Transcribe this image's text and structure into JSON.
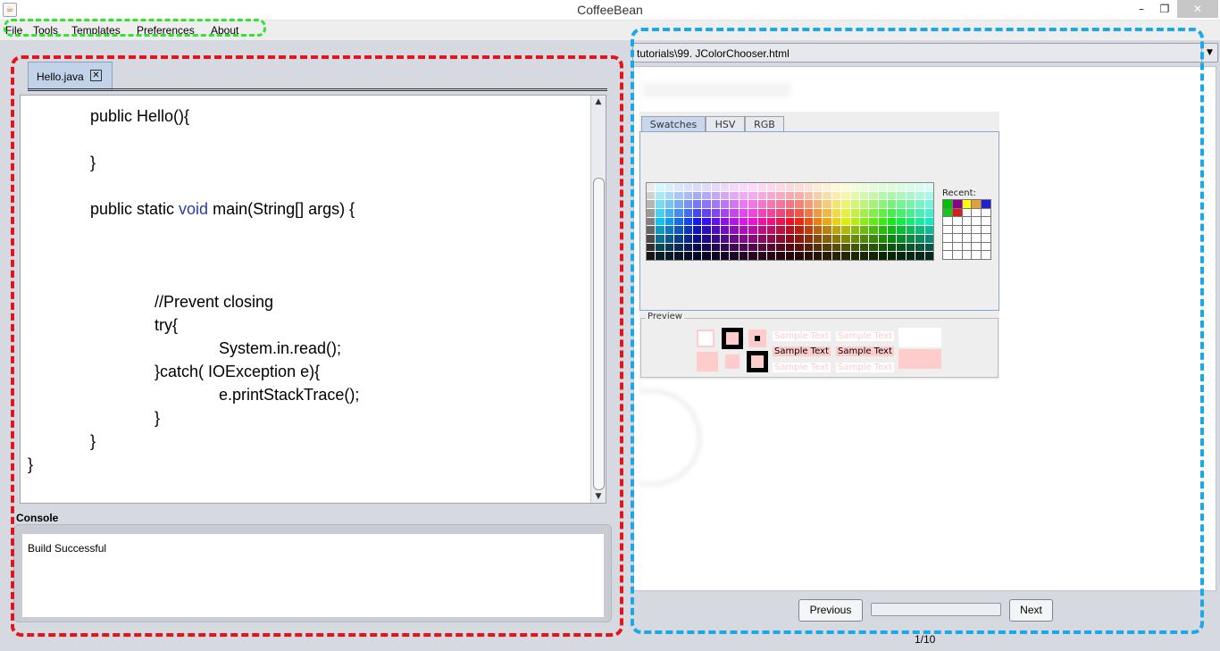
{
  "window": {
    "title": "CoffeeBean",
    "minimize": "–",
    "maximize": "❐",
    "close": "✕"
  },
  "menu": [
    "File",
    "Tools",
    "Templates",
    "Preferences",
    "About"
  ],
  "editor": {
    "tab_label": "Hello.java",
    "tab_close": "✕",
    "lines": [
      {
        "indent": 1,
        "segments": [
          {
            "text": "public Hello(){",
            "kind": "plain"
          }
        ]
      },
      {
        "indent": 1,
        "segments": [
          {
            "text": "}",
            "kind": "plain"
          }
        ]
      },
      {
        "indent": 1,
        "segments": [
          {
            "text": "public static ",
            "kind": "plain"
          },
          {
            "text": "void",
            "kind": "keyword"
          },
          {
            "text": " main(String[] args) {",
            "kind": "plain"
          }
        ]
      },
      {
        "indent": 2,
        "segments": [
          {
            "text": "//Prevent closing",
            "kind": "plain"
          }
        ]
      },
      {
        "indent": 2,
        "segments": [
          {
            "text": "try{",
            "kind": "plain"
          }
        ]
      },
      {
        "indent": 3,
        "segments": [
          {
            "text": "System.in.read();",
            "kind": "plain"
          }
        ]
      },
      {
        "indent": 2,
        "segments": [
          {
            "text": "}catch( IOException e){",
            "kind": "plain"
          }
        ]
      },
      {
        "indent": 3,
        "segments": [
          {
            "text": "e.printStackTrace();",
            "kind": "plain"
          }
        ]
      },
      {
        "indent": 2,
        "segments": [
          {
            "text": "}",
            "kind": "plain"
          }
        ]
      },
      {
        "indent": 1,
        "segments": [
          {
            "text": "}",
            "kind": "plain"
          }
        ]
      },
      {
        "indent": 0,
        "segments": [
          {
            "text": "}",
            "kind": "plain"
          }
        ]
      }
    ],
    "keyword_color": "#283e9a"
  },
  "console": {
    "label": "Console",
    "output": "Build Successful"
  },
  "tutorial": {
    "url": "tutorials\\99. JColorChooser.html",
    "color_chooser": {
      "tabs": [
        "Swatches",
        "HSV",
        "RGB"
      ],
      "recent_label": "Recent:",
      "preview_label": "Preview",
      "sample_text": "Sample Text",
      "recent_colors": [
        "#00c000",
        "#8a008a",
        "#ffff00",
        "#e0a040",
        "#2020d0",
        "#20c020",
        "#d02020"
      ],
      "preview_color": "#ffcccc"
    },
    "previous_label": "Previous",
    "next_label": "Next",
    "page_indicator": "1/10",
    "progress": 0.1
  },
  "highlights": {
    "menu": "#33e233",
    "editor": "#e3141b",
    "tutorial": "#1ba8e8"
  }
}
